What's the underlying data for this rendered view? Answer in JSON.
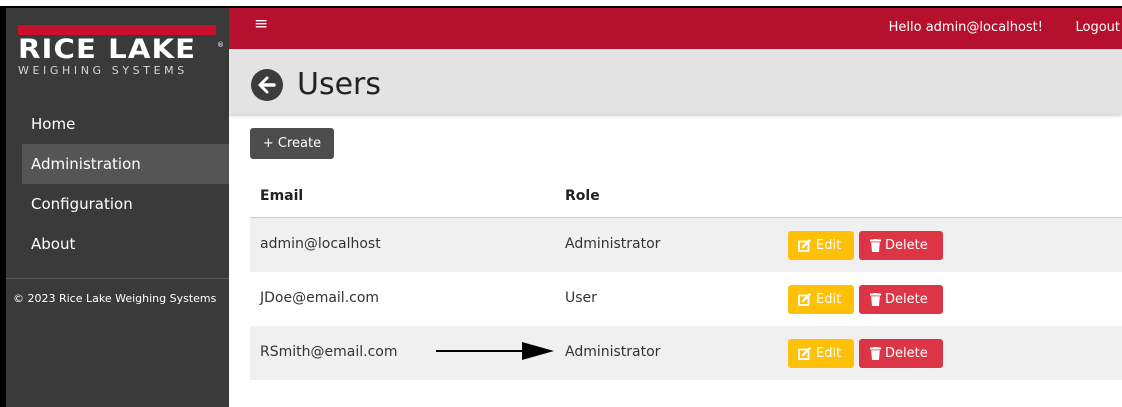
{
  "brand": {
    "name": "RICE LAKE",
    "registered": "®",
    "tagline": "WEIGHING SYSTEMS",
    "accent_color": "#b5112e"
  },
  "sidebar": {
    "items": [
      {
        "label": "Home"
      },
      {
        "label": "Administration",
        "active": true
      },
      {
        "label": "Configuration"
      },
      {
        "label": "About"
      }
    ],
    "copyright": "© 2023 Rice Lake Weighing Systems"
  },
  "topbar": {
    "menu_icon": "hamburger-icon",
    "greeting": "Hello admin@localhost!",
    "logout": "Logout"
  },
  "page": {
    "back_icon": "arrow-left-circle-icon",
    "title": "Users"
  },
  "toolbar": {
    "create_label": "+ Create"
  },
  "table": {
    "headers": [
      "Email",
      "Role"
    ],
    "rows": [
      {
        "email": "admin@localhost",
        "role": "Administrator"
      },
      {
        "email": "JDoe@email.com",
        "role": "User"
      },
      {
        "email": "RSmith@email.com",
        "role": "Administrator"
      }
    ],
    "edit_label": "Edit",
    "delete_label": "Delete",
    "edit_icon": "edit-icon",
    "delete_icon": "trash-icon",
    "edit_color": "#ffc107",
    "delete_color": "#dc3545"
  },
  "annotation": {
    "icon": "pointer-arrow-icon"
  }
}
